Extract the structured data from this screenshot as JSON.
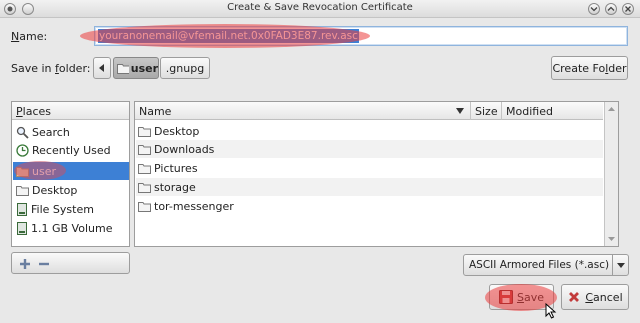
{
  "window": {
    "title": "Create & Save Revocation Certificate"
  },
  "form": {
    "name_label_prefix": "",
    "name_label_mnemonic": "N",
    "name_label_rest": "ame:",
    "name_value": "youranonemail@vfemail.net.0x0FAD3E87.rev.asc",
    "save_in_prefix": "Save in ",
    "save_in_mnemonic": "f",
    "save_in_rest": "older:"
  },
  "path_bar": {
    "segments": [
      "user",
      ".gnupg"
    ]
  },
  "create_folder": {
    "prefix": "Create Fo",
    "mnemonic": "l",
    "rest": "der"
  },
  "places": {
    "header_mnemonic": "P",
    "header_rest": "laces",
    "items": [
      {
        "label": "Search",
        "icon": "search-icon"
      },
      {
        "label": "Recently Used",
        "icon": "recent-icon"
      },
      {
        "label": "user",
        "icon": "home-folder-icon",
        "selected": true
      },
      {
        "label": "Desktop",
        "icon": "folder-icon"
      },
      {
        "label": "File System",
        "icon": "drive-icon"
      },
      {
        "label": "1.1 GB Volume",
        "icon": "drive-icon"
      }
    ]
  },
  "files": {
    "columns": [
      "Name",
      "Size",
      "Modified"
    ],
    "rows": [
      "Desktop",
      "Downloads",
      "Pictures",
      "storage",
      "tor-messenger"
    ]
  },
  "filter": {
    "selected": "ASCII Armored Files (*.asc)"
  },
  "buttons": {
    "save_mnemonic": "S",
    "save_rest": "ave",
    "cancel_mnemonic": "C",
    "cancel_rest": "ancel"
  },
  "colors": {
    "selection": "#3d80d5",
    "annotation_red": "#eb3c3c"
  }
}
